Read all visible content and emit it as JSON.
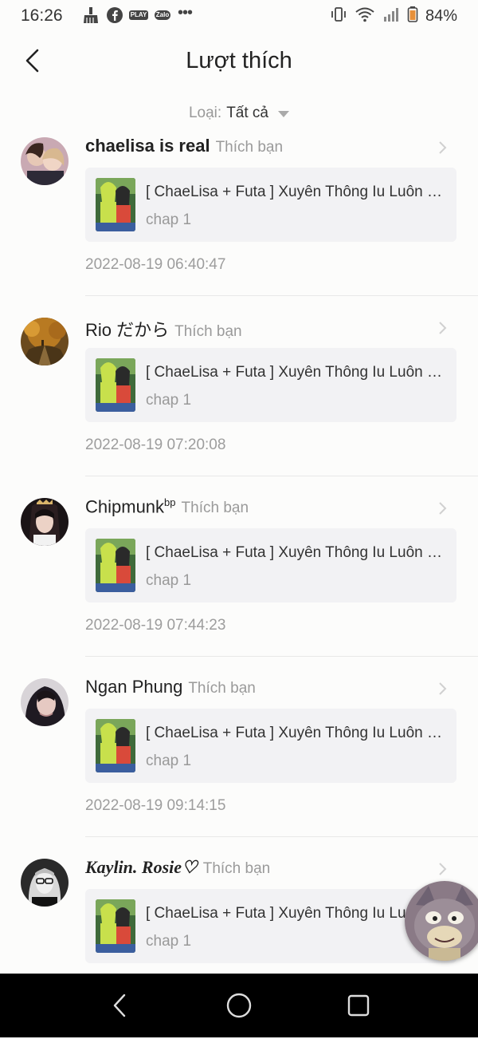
{
  "status_bar": {
    "time": "16:26",
    "badges": [
      "PLAY",
      "Zalo"
    ],
    "more": "•••",
    "battery": "84%",
    "icons": [
      "broom-icon",
      "facebook-icon",
      "play-together-icon",
      "zalo-icon",
      "vibrate-icon",
      "wifi-icon",
      "signal-icon",
      "battery-icon"
    ]
  },
  "header": {
    "title": "Lượt thích",
    "back_icon": "chevron-left-icon"
  },
  "filter": {
    "label": "Loại:",
    "value": "Tất cả"
  },
  "items": [
    {
      "user": "chaelisa is real",
      "action": "Thích bạn",
      "story_title": "[ ChaeLisa + Futa ] Xuyên Thông Iu Luôn Chị Ruột",
      "chapter": "chap 1",
      "time": "2022-08-19 06:40:47"
    },
    {
      "user": "Rio だから",
      "action": "Thích bạn",
      "story_title": "[ ChaeLisa + Futa ] Xuyên Thông Iu Luôn Chị Ruột",
      "chapter": "chap 1",
      "time": "2022-08-19 07:20:08"
    },
    {
      "user": "Chipmunk",
      "user_sup": "bp",
      "action": "Thích bạn",
      "story_title": "[ ChaeLisa + Futa ] Xuyên Thông Iu Luôn Chị Ruột",
      "chapter": "chap 1",
      "time": "2022-08-19 07:44:23"
    },
    {
      "user": "Ngan Phung",
      "action": "Thích bạn",
      "story_title": "[ ChaeLisa + Futa ] Xuyên Thông Iu Luôn Chị Ruột",
      "chapter": "chap 1",
      "time": "2022-08-19 09:14:15"
    },
    {
      "user": "Kaylin. Rosie♡",
      "action": "Thích bạn",
      "story_title": "[ ChaeLisa + Futa ] Xuyên Thông Iu Luôn Chị Ruột",
      "chapter": "chap 1",
      "time": ""
    }
  ],
  "nav_bar": {
    "icons": [
      "nav-back-icon",
      "nav-home-icon",
      "nav-recents-icon"
    ]
  },
  "colors": {
    "background": "#fcfcfb",
    "card": "#f2f2f4",
    "secondary_text": "#999999",
    "nav_bar": "#000000"
  }
}
